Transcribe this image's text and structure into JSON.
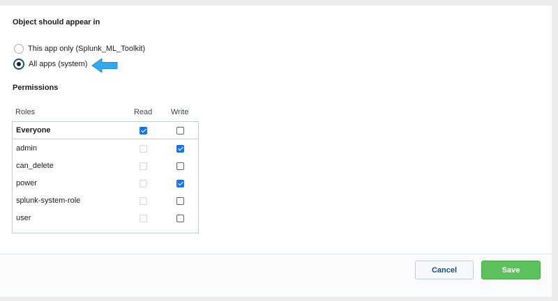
{
  "sharing": {
    "title": "Object should appear in",
    "options": [
      {
        "label": "This app only (Splunk_ML_Toolkit)",
        "selected": false
      },
      {
        "label": "All apps (system)",
        "selected": true
      }
    ],
    "pointer_icon": "arrow-left-icon",
    "pointer_color": "#33a9ec"
  },
  "permissions": {
    "title": "Permissions",
    "columns": {
      "roles": "Roles",
      "read": "Read",
      "write": "Write"
    },
    "rows": [
      {
        "role": "Everyone",
        "read": true,
        "read_enabled": true,
        "write": false
      },
      {
        "role": "admin",
        "read": false,
        "read_enabled": false,
        "write": true
      },
      {
        "role": "can_delete",
        "read": false,
        "read_enabled": false,
        "write": false
      },
      {
        "role": "power",
        "read": false,
        "read_enabled": false,
        "write": true
      },
      {
        "role": "splunk-system-role",
        "read": false,
        "read_enabled": false,
        "write": false
      },
      {
        "role": "user",
        "read": false,
        "read_enabled": false,
        "write": false
      }
    ]
  },
  "footer": {
    "cancel_label": "Cancel",
    "save_label": "Save"
  },
  "colors": {
    "accent": "#1e4c7e",
    "checkbox_checked": "#1a73e8",
    "save_button": "#5cc05c"
  }
}
